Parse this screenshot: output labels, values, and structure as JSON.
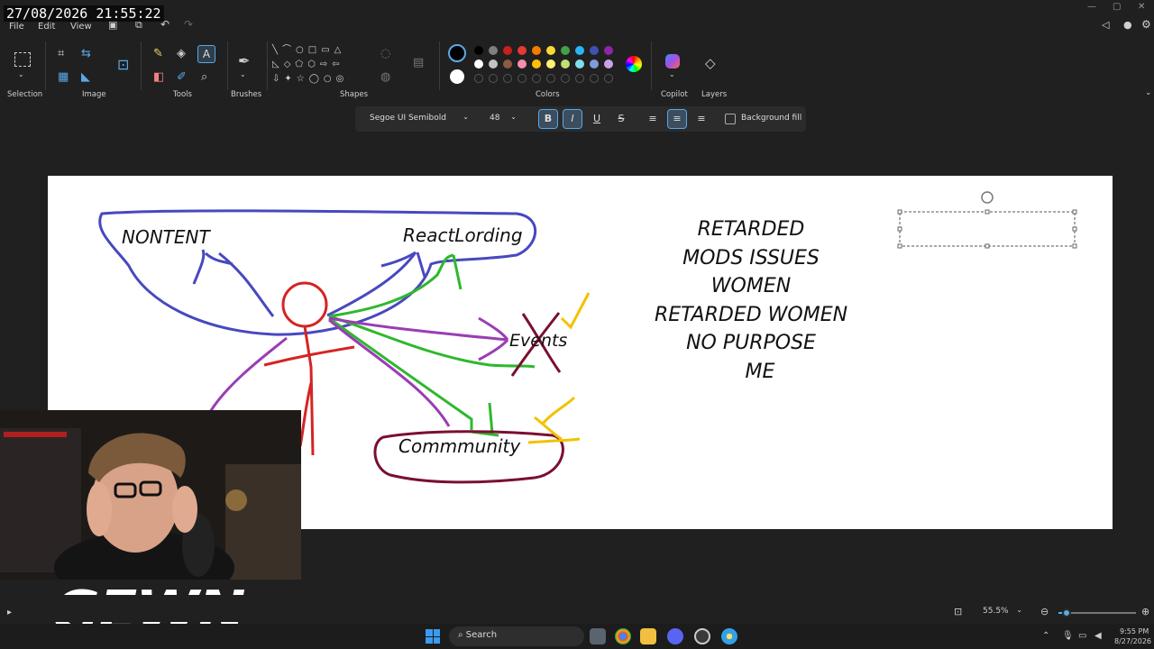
{
  "overlay": {
    "timestamp": "27/08/2026 21:55:22"
  },
  "menu": {
    "items": [
      "File",
      "Edit",
      "View"
    ]
  },
  "ribbon": {
    "groups": {
      "selection": "Selection",
      "image": "Image",
      "tools": "Tools",
      "brushes": "Brushes",
      "shapes": "Shapes",
      "colors": "Colors",
      "copilot": "Copilot",
      "layers": "Layers"
    },
    "palette_row1": [
      "#000000",
      "#7f7f7f",
      "#c81e1e",
      "#e53935",
      "#f57c00",
      "#fdd835",
      "#43a047",
      "#29b6f6",
      "#3f51b5",
      "#8e24aa"
    ],
    "palette_row2": [
      "#ffffff",
      "#c3c3c3",
      "#8d5b3f",
      "#f48fb1",
      "#ffc107",
      "#fff176",
      "#c0e070",
      "#80deea",
      "#7e9cd8",
      "#c8a2e8"
    ],
    "primary_color": "#000000",
    "secondary_color": "#ffffff"
  },
  "text_toolbar": {
    "font": "Segoe UI Semibold",
    "size": "48",
    "background_fill": "Background fill",
    "bold_glyph": "B",
    "italic_glyph": "I",
    "underline_glyph": "U",
    "strike_glyph": "S"
  },
  "canvas_text": {
    "nontent": "NONTENT",
    "reactlording": "ReactLording",
    "events": "Events",
    "community": "Commmunity",
    "list": [
      "RETARDED",
      "MODS ISSUES",
      "WOMEN",
      "RETARDED WOMEN",
      "NO PURPOSE",
      "ME"
    ]
  },
  "branding": {
    "logo": "GEWN"
  },
  "status": {
    "zoom": "55.5%",
    "zoom_level": 0.1
  },
  "taskbar": {
    "search": "Search",
    "time": "9:55 PM",
    "date": "8/27/2026"
  }
}
